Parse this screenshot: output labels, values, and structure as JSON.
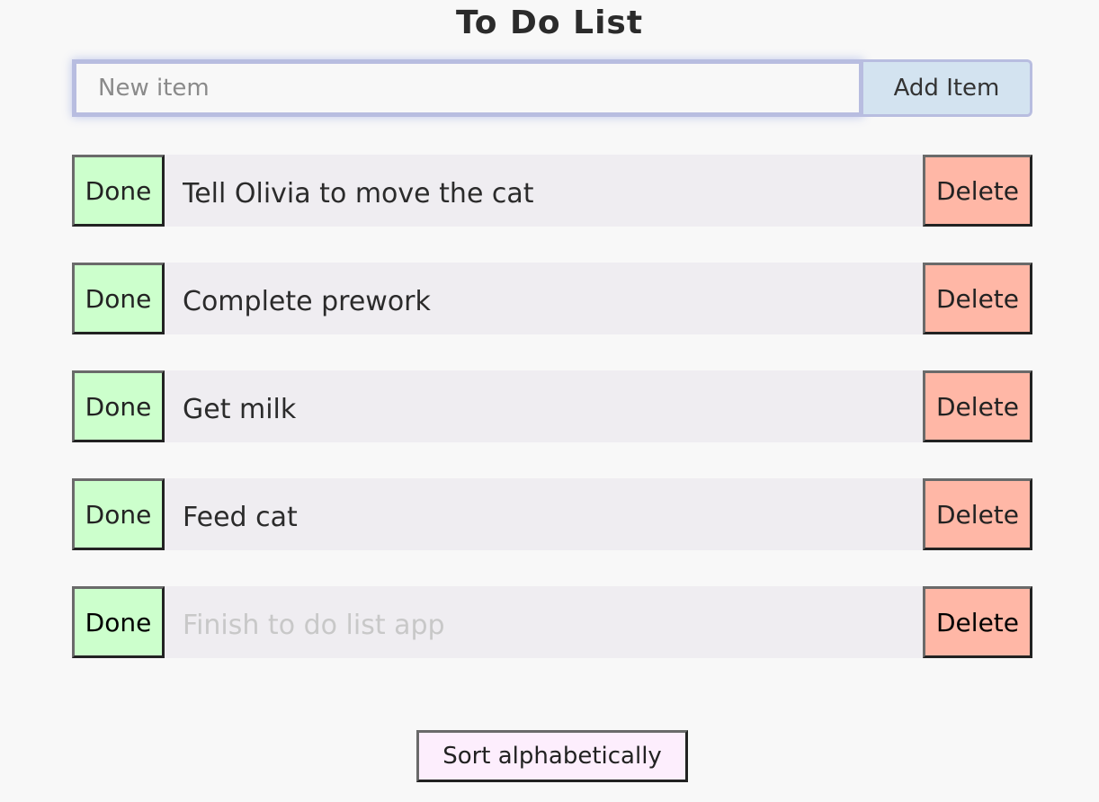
{
  "header": {
    "title": "To Do List"
  },
  "add_form": {
    "placeholder": "New item",
    "value": "",
    "add_button_label": "Add Item"
  },
  "items": [
    {
      "text": "Tell Olivia to move the cat",
      "done_label": "Done",
      "delete_label": "Delete",
      "completed": false
    },
    {
      "text": "Complete prework",
      "done_label": "Done",
      "delete_label": "Delete",
      "completed": false
    },
    {
      "text": "Get milk",
      "done_label": "Done",
      "delete_label": "Delete",
      "completed": false
    },
    {
      "text": "Feed cat",
      "done_label": "Done",
      "delete_label": "Delete",
      "completed": false
    },
    {
      "text": "Finish to do list app",
      "done_label": "Done",
      "delete_label": "Delete",
      "completed": true
    }
  ],
  "footer": {
    "sort_button_label": "Sort alphabetically"
  },
  "colors": {
    "background": "#f8f8f8",
    "done_button": "#ccffcc",
    "delete_button": "#ffb7a6",
    "add_button": "#d3e3f0",
    "sort_button": "#fdeefd",
    "row_background": "#efedf1",
    "completed_text": "#c8c8c8"
  }
}
